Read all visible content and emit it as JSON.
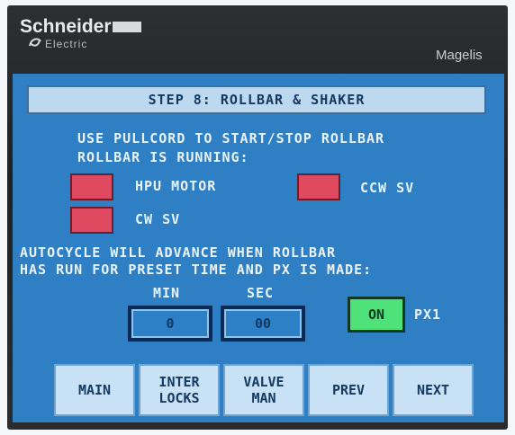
{
  "device": {
    "brand": "Schneider",
    "brand_sub": "Electric",
    "model": "Magelis"
  },
  "screen": {
    "title": "STEP 8: ROLLBAR & SHAKER",
    "instruction": "USE PULLCORD TO START/STOP ROLLBAR",
    "status_heading": "ROLLBAR IS RUNNING:",
    "indicators": [
      {
        "label": "HPU MOTOR",
        "state": "off",
        "color": "#e04a60"
      },
      {
        "label": "CCW SV",
        "state": "off",
        "color": "#e04a60"
      },
      {
        "label": "CW SV",
        "state": "off",
        "color": "#e04a60"
      }
    ],
    "autocycle_line1": "AUTOCYCLE WILL ADVANCE WHEN ROLLBAR",
    "autocycle_line2": "HAS RUN FOR PRESET TIME AND PX IS MADE:",
    "timer": {
      "min_label": "MIN",
      "min_value": "0",
      "sec_label": "SEC",
      "sec_value": "00"
    },
    "px": {
      "state_label": "ON",
      "name": "PX1",
      "color": "#4fe27a"
    }
  },
  "buttons": [
    {
      "label": "MAIN"
    },
    {
      "label": "INTER\nLOCKS"
    },
    {
      "label": "VALVE\nMAN"
    },
    {
      "label": "PREV"
    },
    {
      "label": "NEXT"
    }
  ],
  "colors": {
    "screen_bg": "#2f7fc4",
    "button_bg": "#c8e1f4",
    "alarm_red": "#e04a60"
  }
}
